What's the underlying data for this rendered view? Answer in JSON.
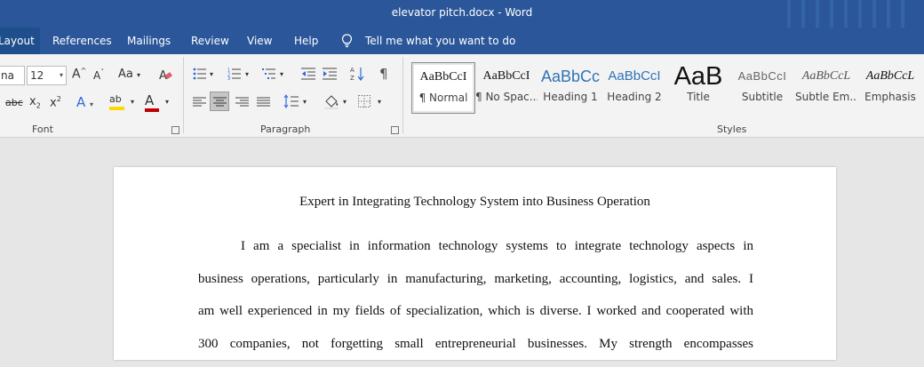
{
  "window": {
    "title": "elevator pitch.docx  -  Word"
  },
  "tabs": [
    {
      "label": "Layout"
    },
    {
      "label": "References"
    },
    {
      "label": "Mailings"
    },
    {
      "label": "Review"
    },
    {
      "label": "View"
    },
    {
      "label": "Help"
    }
  ],
  "tell_me": {
    "label": "Tell me what you want to do"
  },
  "font_group": {
    "label": "Font",
    "font_name": "na",
    "font_size": "12",
    "grow_label": "A",
    "shrink_label": "A",
    "case_label": "Aa",
    "strike_label": "abc",
    "subscript_label": "x",
    "superscript_label": "x",
    "sub_digit": "2",
    "sup_digit": "2",
    "effects_label": "A",
    "highlight_label": "ab",
    "color_label": "A",
    "highlight_color": "#ffd700",
    "font_color": "#c00000"
  },
  "paragraph_group": {
    "label": "Paragraph",
    "pilcrow": "¶"
  },
  "styles_group": {
    "label": "Styles",
    "items": [
      {
        "sample": "AaBbCcI",
        "name": "¶ Normal"
      },
      {
        "sample": "AaBbCcI",
        "name": "¶ No Spac..."
      },
      {
        "sample": "AaBbCc",
        "name": "Heading 1"
      },
      {
        "sample": "AaBbCcI",
        "name": "Heading 2"
      },
      {
        "sample": "AaB",
        "name": "Title"
      },
      {
        "sample": "AaBbCcI",
        "name": "Subtitle"
      },
      {
        "sample": "AaBbCcL",
        "name": "Subtle Em..."
      },
      {
        "sample": "AaBbCcL",
        "name": "Emphasis"
      }
    ]
  },
  "document": {
    "title": "Expert in Integrating Technology System into Business Operation",
    "lines": [
      "I am a specialist in information technology systems to integrate technology aspects in",
      "business operations, particularly in manufacturing, marketing, accounting, logistics, and sales. I",
      "am well experienced in my fields of specialization, which is diverse. I worked and cooperated with",
      "300 companies, not forgetting small entrepreneurial businesses. My strength encompasses"
    ]
  },
  "colors": {
    "titlebar": "#2b579a",
    "heading_blue": "#2e74b5"
  }
}
